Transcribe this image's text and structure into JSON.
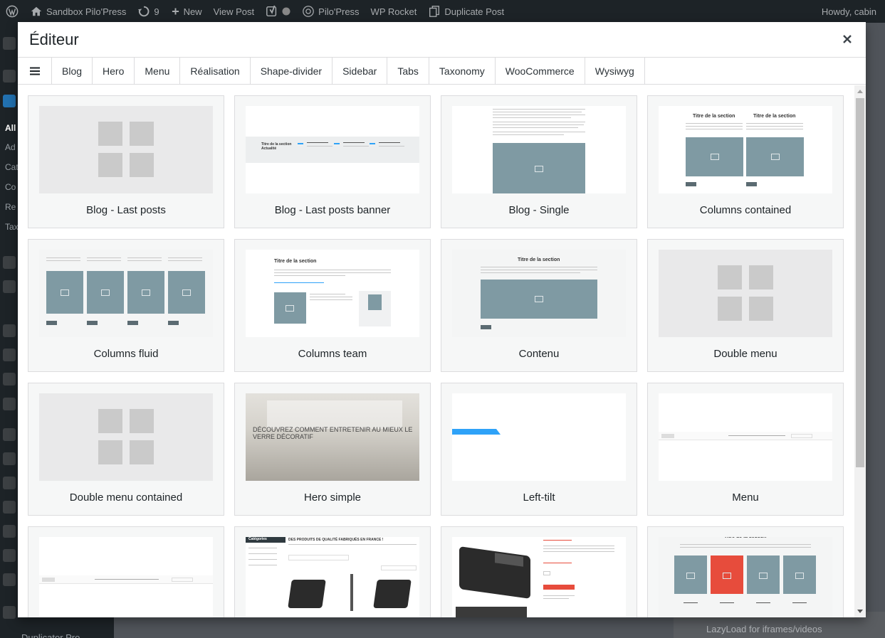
{
  "admin_bar": {
    "site_name": "Sandbox Pilo'Press",
    "updates_count": "9",
    "new_label": "New",
    "view_post_label": "View Post",
    "pilopress_label": "Pilo'Press",
    "wp_rocket_label": "WP Rocket",
    "duplicate_post_label": "Duplicate Post",
    "howdy": "Howdy, cabin"
  },
  "background": {
    "sidebar_labels": [
      "All",
      "Ad",
      "Cat",
      "Co",
      "Re",
      "Tax"
    ],
    "sidebar_footer": "Duplicator Pro",
    "right_panel_text": "LazyLoad for iframes/videos"
  },
  "modal": {
    "title": "Éditeur",
    "close_label": "×",
    "tabs": [
      "Blog",
      "Hero",
      "Menu",
      "Réalisation",
      "Shape-divider",
      "Sidebar",
      "Tabs",
      "Taxonomy",
      "WooCommerce",
      "Wysiwyg"
    ],
    "layouts": [
      "Blog - Last posts",
      "Blog - Last posts banner",
      "Blog - Single",
      "Columns contained",
      "Columns fluid",
      "Columns team",
      "Contenu",
      "Double menu",
      "Double menu contained",
      "Hero simple",
      "Left-tilt",
      "Menu",
      "",
      "",
      "",
      ""
    ],
    "thumb_texts": {
      "section_title": "Titre de la section",
      "section_title_news": "Titre de la section Actualité",
      "hero_caption": "DÉCOUVREZ COMMENT ENTRETENIR AU MIEUX LE VERRE DÉCORATIF",
      "shop_title": "DES PRODUITS DE QUALITÉ FABRIQUÉS EN FRANCE !",
      "shop_sidebar_title": "Catégories",
      "button_mini": "Bouton"
    }
  },
  "colors": {
    "admin_bar_bg": "#1d2327",
    "modal_bg": "#ffffff",
    "card_bg": "#f6f7f7",
    "thumb_blue": "#7f9aa3",
    "accent_blue": "#2ea2f8",
    "accent_red": "#e74c3c"
  }
}
